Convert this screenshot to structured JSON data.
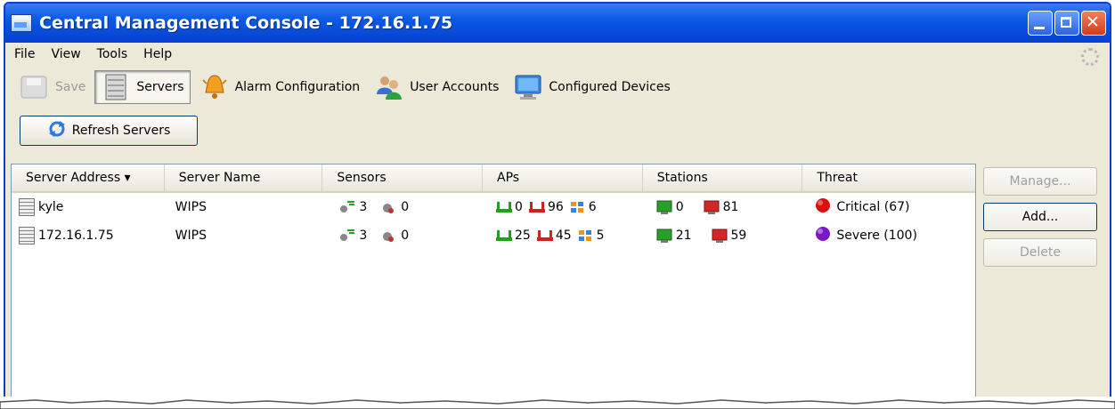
{
  "window": {
    "title": "Central Management Console - 172.16.1.75"
  },
  "menu": [
    "File",
    "View",
    "Tools",
    "Help"
  ],
  "toolbar": {
    "save": "Save",
    "servers": "Servers",
    "alarm": "Alarm Configuration",
    "users": "User Accounts",
    "devices": "Configured Devices"
  },
  "refresh_label": "Refresh Servers",
  "table": {
    "headers": [
      "Server Address ▾",
      "Server Name",
      "Sensors",
      "APs",
      "Stations",
      "Threat"
    ],
    "rows": [
      {
        "address": "kyle",
        "name": "WIPS",
        "sensors_up": "3",
        "sensors_down": "0",
        "aps_auth": "0",
        "aps_rogue": "96",
        "aps_other": "6",
        "sta_auth": "0",
        "sta_rogue": "81",
        "threat": "Critical (67)"
      },
      {
        "address": "172.16.1.75",
        "name": "WIPS",
        "sensors_up": "3",
        "sensors_down": "0",
        "aps_auth": "25",
        "aps_rogue": "45",
        "aps_other": "5",
        "sta_auth": "21",
        "sta_rogue": "59",
        "threat": "Severe (100)"
      }
    ]
  },
  "side": {
    "manage": "Manage...",
    "add": "Add...",
    "delete": "Delete"
  },
  "colors": {
    "critical": "#d81010",
    "severe": "#7a18c8",
    "title_bar": "#0a5ae6"
  }
}
